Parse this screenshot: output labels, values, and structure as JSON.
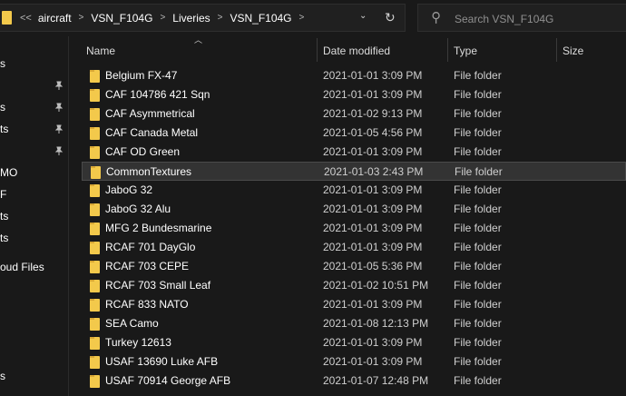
{
  "address_bar": {
    "overflow": "<<",
    "crumbs": [
      "aircraft",
      "VSN_F104G",
      "Liveries",
      "VSN_F104G"
    ],
    "chevron": ">",
    "dropdown": "⌄",
    "refresh": "↻"
  },
  "search": {
    "placeholder": "Search VSN_F104G",
    "value": ""
  },
  "nav_pane": {
    "items": [
      "s",
      "s",
      "s",
      "ts",
      "MO",
      "F",
      "ts",
      "ts",
      "oud Files",
      "s"
    ],
    "pinned": [
      true,
      false,
      true,
      true,
      true,
      false,
      false,
      false,
      false,
      false
    ]
  },
  "columns": {
    "name": "Name",
    "date": "Date modified",
    "type": "Type",
    "size": "Size"
  },
  "rows": [
    {
      "name": "Belgium FX-47",
      "date": "2021-01-01 3:09 PM",
      "type": "File folder",
      "selected": false
    },
    {
      "name": "CAF 104786 421 Sqn",
      "date": "2021-01-01 3:09 PM",
      "type": "File folder",
      "selected": false
    },
    {
      "name": "CAF Asymmetrical",
      "date": "2021-01-02 9:13 PM",
      "type": "File folder",
      "selected": false
    },
    {
      "name": "CAF Canada Metal",
      "date": "2021-01-05 4:56 PM",
      "type": "File folder",
      "selected": false
    },
    {
      "name": "CAF OD Green",
      "date": "2021-01-01 3:09 PM",
      "type": "File folder",
      "selected": false
    },
    {
      "name": "CommonTextures",
      "date": "2021-01-03 2:43 PM",
      "type": "File folder",
      "selected": true
    },
    {
      "name": "JaboG 32",
      "date": "2021-01-01 3:09 PM",
      "type": "File folder",
      "selected": false
    },
    {
      "name": "JaboG 32 Alu",
      "date": "2021-01-01 3:09 PM",
      "type": "File folder",
      "selected": false
    },
    {
      "name": "MFG 2 Bundesmarine",
      "date": "2021-01-01 3:09 PM",
      "type": "File folder",
      "selected": false
    },
    {
      "name": "RCAF 701 DayGlo",
      "date": "2021-01-01 3:09 PM",
      "type": "File folder",
      "selected": false
    },
    {
      "name": "RCAF 703 CEPE",
      "date": "2021-01-05 5:36 PM",
      "type": "File folder",
      "selected": false
    },
    {
      "name": "RCAF 703 Small Leaf",
      "date": "2021-01-02 10:51 PM",
      "type": "File folder",
      "selected": false
    },
    {
      "name": "RCAF 833 NATO",
      "date": "2021-01-01 3:09 PM",
      "type": "File folder",
      "selected": false
    },
    {
      "name": "SEA Camo",
      "date": "2021-01-08 12:13 PM",
      "type": "File folder",
      "selected": false
    },
    {
      "name": "Turkey 12613",
      "date": "2021-01-01 3:09 PM",
      "type": "File folder",
      "selected": false
    },
    {
      "name": "USAF 13690 Luke AFB",
      "date": "2021-01-01 3:09 PM",
      "type": "File folder",
      "selected": false
    },
    {
      "name": "USAF 70914 George AFB",
      "date": "2021-01-07 12:48 PM",
      "type": "File folder",
      "selected": false
    }
  ],
  "colors": {
    "background": "#191919",
    "folder": "#f3c94b",
    "selected_row": "#333333",
    "text": "#ffffff",
    "muted_text": "#cfcfcf"
  },
  "icons": {
    "folder": "folder-icon",
    "search": "search-icon",
    "pin": "pin-icon",
    "refresh": "refresh-icon"
  }
}
